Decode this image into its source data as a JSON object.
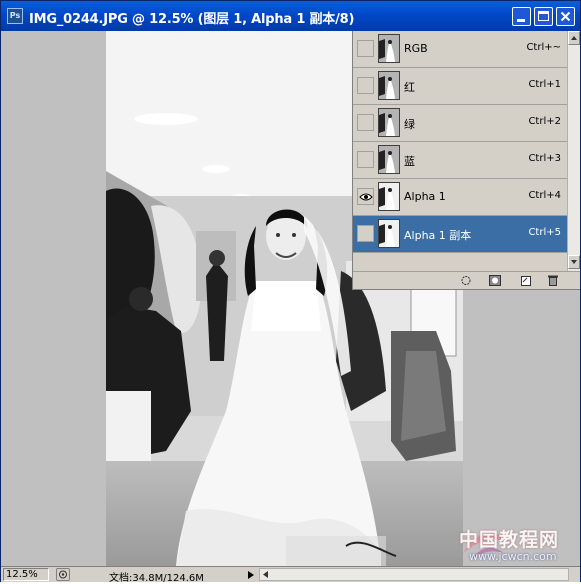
{
  "window": {
    "title": "IMG_0244.JPG @ 12.5% (图层 1, Alpha 1 副本/8)",
    "app_icon": "photoshop-icon",
    "buttons": [
      "minimize-icon",
      "maximize-icon",
      "close-icon"
    ]
  },
  "channels_panel": {
    "channels": [
      {
        "name": "RGB",
        "shortcut": "Ctrl+~",
        "visible": false,
        "selected": false
      },
      {
        "name": "红",
        "shortcut": "Ctrl+1",
        "visible": false,
        "selected": false
      },
      {
        "name": "绿",
        "shortcut": "Ctrl+2",
        "visible": false,
        "selected": false
      },
      {
        "name": "蓝",
        "shortcut": "Ctrl+3",
        "visible": false,
        "selected": false
      },
      {
        "name": "Alpha 1",
        "shortcut": "Ctrl+4",
        "visible": true,
        "selected": false
      },
      {
        "name": "Alpha 1 副本",
        "shortcut": "Ctrl+5",
        "visible": false,
        "selected": true
      }
    ],
    "footer_icons": [
      "load-selection-icon",
      "save-selection-icon",
      "new-channel-icon",
      "trash-icon"
    ]
  },
  "status_bar": {
    "zoom": "12.5%",
    "doc_info": "文档:34.8M/124.6M"
  },
  "watermark": {
    "cn": "中国教程网",
    "url": "www.jcwcn.com"
  },
  "colors": {
    "title_bar": "#0a5fd8",
    "panel_bg": "#d4d0c8",
    "selected_row": "#3a6ea5",
    "canvas_bg": "#c0c0c0"
  }
}
